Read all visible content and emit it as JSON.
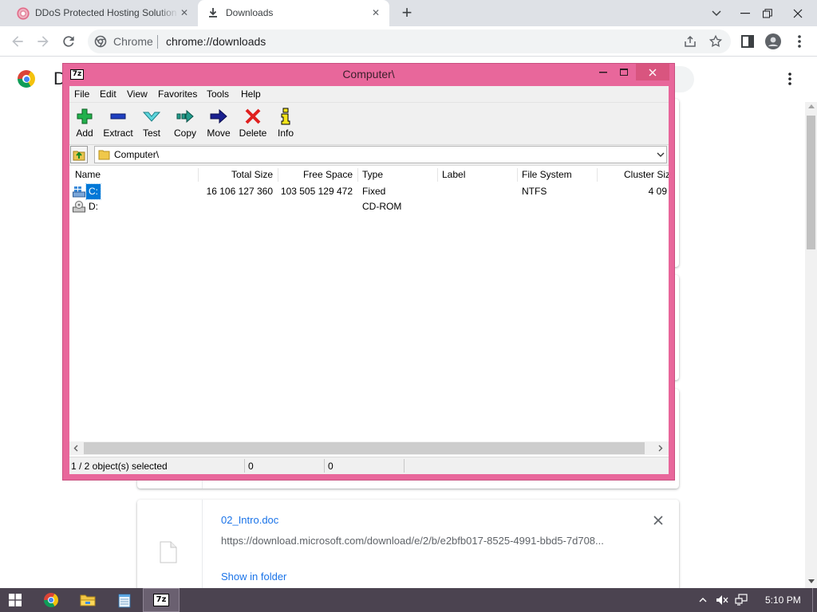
{
  "browser": {
    "tabs": [
      {
        "title": "DDoS Protected Hosting Solution",
        "active": false
      },
      {
        "title": "Downloads",
        "active": true
      }
    ],
    "omnibox": {
      "site_label": "Chrome",
      "url": "chrome://downloads"
    }
  },
  "downloads_page": {
    "heading": "D",
    "items": [
      {
        "filename": "02_Intro.doc",
        "url": "https://download.microsoft.com/download/e/2/b/e2bfb017-8525-4991-bbd5-7d708...",
        "action": "Show in folder"
      }
    ]
  },
  "sevenzip": {
    "logo_text": "7z",
    "title": "Computer\\",
    "menu": [
      "File",
      "Edit",
      "View",
      "Favorites",
      "Tools",
      "Help"
    ],
    "toolbar": [
      {
        "label": "Add",
        "icon": "add-icon"
      },
      {
        "label": "Extract",
        "icon": "extract-icon"
      },
      {
        "label": "Test",
        "icon": "test-icon"
      },
      {
        "label": "Copy",
        "icon": "copy-icon"
      },
      {
        "label": "Move",
        "icon": "move-icon"
      },
      {
        "label": "Delete",
        "icon": "delete-icon"
      },
      {
        "label": "Info",
        "icon": "info-icon"
      }
    ],
    "path": "Computer\\",
    "columns": [
      "Name",
      "Total Size",
      "Free Space",
      "Type",
      "Label",
      "File System",
      "Cluster Siz"
    ],
    "rows": [
      {
        "name": "C:",
        "total_size": "16 106 127 360",
        "free_space": "103 505 129 472",
        "type": "Fixed",
        "label": "",
        "file_system": "NTFS",
        "cluster_size": "4 09",
        "selected": true,
        "icon": "fixed-drive-icon"
      },
      {
        "name": "D:",
        "total_size": "",
        "free_space": "",
        "type": "CD-ROM",
        "label": "",
        "file_system": "",
        "cluster_size": "",
        "selected": false,
        "icon": "cd-drive-icon"
      }
    ],
    "status": [
      "1 / 2 object(s) selected",
      "0",
      "0"
    ]
  },
  "taskbar": {
    "apps": [
      {
        "icon": "chrome-icon",
        "active": false
      },
      {
        "icon": "file-explorer-icon",
        "active": false
      },
      {
        "icon": "notepad-icon",
        "active": false
      },
      {
        "icon": "7zip-icon",
        "active": true
      }
    ],
    "clock": "5:10 PM"
  },
  "colors": {
    "window_frame": "#e8679b",
    "selection": "#0078d7",
    "link": "#1a73e8",
    "taskbar": "#4b4350"
  }
}
